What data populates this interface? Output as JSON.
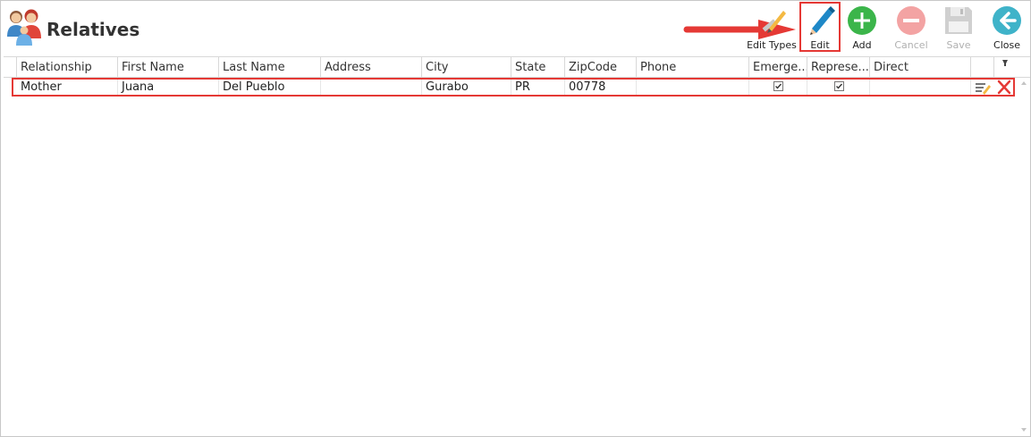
{
  "window": {
    "title": "Relatives"
  },
  "toolbar": {
    "buttons": [
      {
        "id": "edit-types",
        "label": "Edit Types",
        "icon": "pencil-ruler-icon",
        "enabled": true
      },
      {
        "id": "edit",
        "label": "Edit",
        "icon": "pencil-icon",
        "enabled": true
      },
      {
        "id": "add",
        "label": "Add",
        "icon": "plus-circle-icon",
        "enabled": true
      },
      {
        "id": "cancel",
        "label": "Cancel",
        "icon": "minus-circle-icon",
        "enabled": false
      },
      {
        "id": "save",
        "label": "Save",
        "icon": "floppy-disk-icon",
        "enabled": false
      },
      {
        "id": "close",
        "label": "Close",
        "icon": "arrow-left-circle-icon",
        "enabled": true
      }
    ]
  },
  "grid": {
    "columns": [
      "Relationship",
      "First Name",
      "Last Name",
      "Address",
      "City",
      "State",
      "ZipCode",
      "Phone",
      "Emerge...",
      "Represe...",
      "Direct"
    ],
    "rows": [
      {
        "cells": [
          "Mother",
          "Juana",
          "Del Pueblo",
          "",
          "Gurabo",
          "PR",
          "00778",
          "",
          "",
          "",
          ""
        ],
        "emergency": true,
        "representative": true
      }
    ]
  },
  "colors": {
    "accent_red": "#e53935",
    "add_green": "#3bb54a",
    "close_teal": "#3fb3c9",
    "edit_blue": "#1e88c7"
  }
}
